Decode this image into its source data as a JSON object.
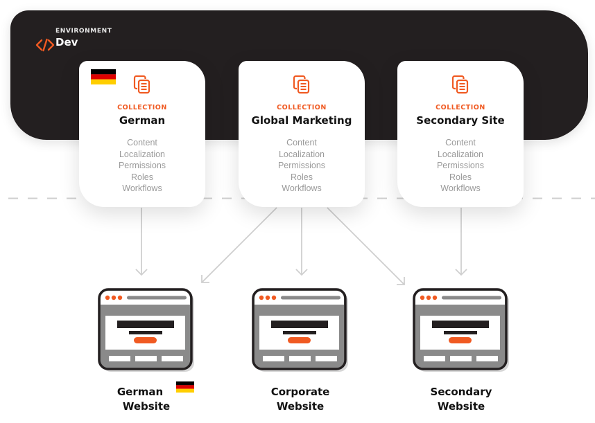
{
  "environment": {
    "icon": "code-brackets-icon",
    "label": "ENVIRONMENT",
    "name": "Dev"
  },
  "colors": {
    "accent": "#f05a22",
    "panel": "#231f20",
    "muted_text": "#9a9a9a",
    "connector": "#cfcfcf"
  },
  "collections": [
    {
      "kicker": "COLLECTION",
      "title": "German",
      "flag": "germany-flag",
      "icon": "collection-icon",
      "items": [
        "Content",
        "Localization",
        "Permissions",
        "Roles",
        "Workflows"
      ]
    },
    {
      "kicker": "COLLECTION",
      "title": "Global Marketing",
      "icon": "collection-icon",
      "items": [
        "Content",
        "Localization",
        "Permissions",
        "Roles",
        "Workflows"
      ]
    },
    {
      "kicker": "COLLECTION",
      "title": "Secondary Site",
      "icon": "collection-icon",
      "items": [
        "Content",
        "Localization",
        "Permissions",
        "Roles",
        "Workflows"
      ]
    }
  ],
  "websites": [
    {
      "line1": "German",
      "line2": "Website",
      "flag": "germany-flag",
      "icon": "browser-window-icon"
    },
    {
      "line1": "Corporate",
      "line2": "Website",
      "icon": "browser-window-icon"
    },
    {
      "line1": "Secondary",
      "line2": "Website",
      "icon": "browser-window-icon"
    }
  ],
  "connections": [
    {
      "from": "German",
      "to": "German Website"
    },
    {
      "from": "Global Marketing",
      "to": "German Website"
    },
    {
      "from": "Global Marketing",
      "to": "Corporate Website"
    },
    {
      "from": "Global Marketing",
      "to": "Secondary Website"
    },
    {
      "from": "Secondary Site",
      "to": "Secondary Website"
    }
  ]
}
